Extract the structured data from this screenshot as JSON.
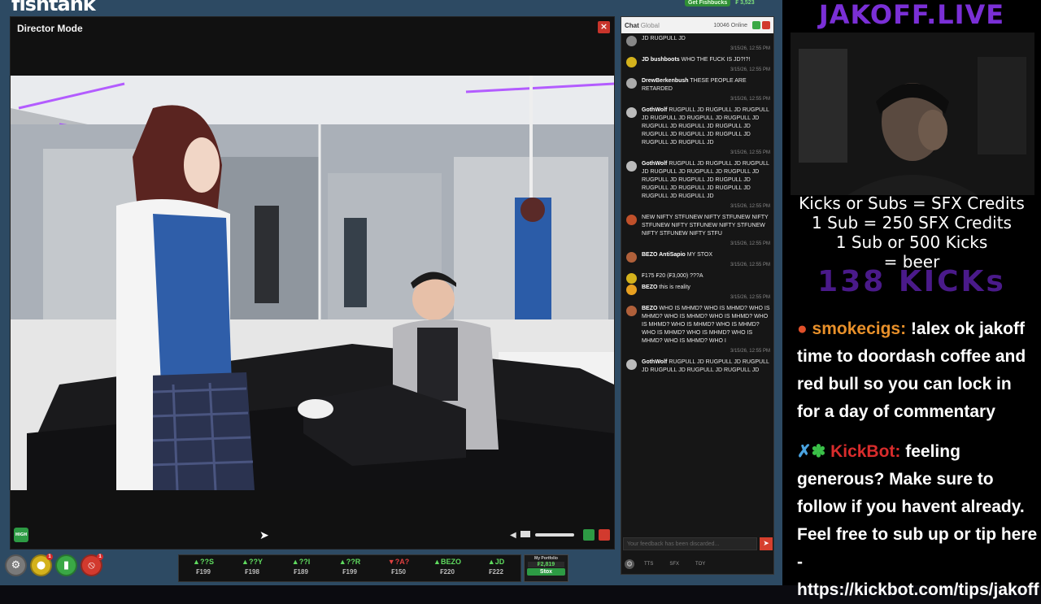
{
  "app": {
    "logo": "fishtank",
    "get_fishbucks": "Get Fishbucks",
    "fishbucks_balance": "₣ 3,523"
  },
  "director": {
    "title": "Director Mode",
    "close": "×",
    "quality_badge": "HIGH"
  },
  "stox": {
    "items": [
      {
        "symbol": "▲??S",
        "price": "₣199",
        "dir": "up"
      },
      {
        "symbol": "▲??Y",
        "price": "₣198",
        "dir": "up"
      },
      {
        "symbol": "▲??I",
        "price": "₣189",
        "dir": "up"
      },
      {
        "symbol": "▲??R",
        "price": "₣199",
        "dir": "up"
      },
      {
        "symbol": "▼?A?",
        "price": "₣150",
        "dir": "down"
      },
      {
        "symbol": "▲BEZO",
        "price": "₣220",
        "dir": "up"
      },
      {
        "symbol": "▲JD",
        "price": "₣222",
        "dir": "up"
      }
    ],
    "portfolio_title": "My Portfolio",
    "portfolio_value": "₣2,819",
    "stox_button": "Stox"
  },
  "bottom_icons": [
    {
      "name": "settings-icon",
      "glyph": "⚙",
      "color": "#7a7a7a",
      "badge": ""
    },
    {
      "name": "coins-icon",
      "glyph": "●",
      "color": "#d4b21c",
      "badge": "1"
    },
    {
      "name": "drink-icon",
      "glyph": "▮",
      "color": "#3aa845",
      "badge": ""
    },
    {
      "name": "no-entry-icon",
      "glyph": "⦸",
      "color": "#d23a2e",
      "badge": "1"
    }
  ],
  "chat": {
    "title": "Chat",
    "subtitle": "Global",
    "online": "10046 Online",
    "input_placeholder": "Your feedback has been discarded...",
    "send": "➤",
    "tabs": [
      "TTS",
      "SFX",
      "TOY"
    ],
    "messages": [
      {
        "user": "",
        "text": "JD RUGPULL JD",
        "ts": "3/15/26, 12:55 PM",
        "av": "#888"
      },
      {
        "user": "JD bushboots",
        "text": "WHO THE FUCK IS JD?!?!",
        "ts": "3/15/26, 12:55 PM",
        "av": "#d4b21c"
      },
      {
        "user": "DrewBerkenbush",
        "text": "THESE PEOPLE ARE RETARDED",
        "ts": "3/15/26, 12:55 PM",
        "av": "#aaa"
      },
      {
        "user": "GothWolf",
        "text": "RUGPULL JD RUGPULL JD RUGPULL JD RUGPULL JD RUGPULL JD RUGPULL JD RUGPULL JD RUGPULL JD RUGPULL JD RUGPULL JD RUGPULL JD RUGPULL JD RUGPULL JD RUGPULL JD",
        "ts": "3/15/26, 12:55 PM",
        "av": "#bbb"
      },
      {
        "user": "GothWolf",
        "text": "RUGPULL JD RUGPULL JD RUGPULL JD RUGPULL JD RUGPULL JD RUGPULL JD RUGPULL JD RUGPULL JD RUGPULL JD RUGPULL JD RUGPULL JD RUGPULL JD RUGPULL JD RUGPULL JD",
        "ts": "3/15/26, 12:55 PM",
        "av": "#bbb"
      },
      {
        "user": "",
        "text": "NEW NIFTY STFUNEW NIFTY STFUNEW NIFTY STFUNEW NIFTY STFUNEW NIFTY STFUNEW NIFTY STFUNEW NIFTY STFU",
        "ts": "3/15/26, 12:55 PM",
        "av": "#c0502a"
      },
      {
        "user": "BEZO AntiSapio",
        "text": "MY STOX",
        "ts": "3/15/26, 12:55 PM",
        "av": "#b0603a"
      },
      {
        "user": "",
        "text": "₣175 ₣20 (₣3,000) ???A",
        "ts": "",
        "av": "#d4b21c"
      },
      {
        "user": "BEZO",
        "text": "this is reality",
        "ts": "3/15/26, 12:55 PM",
        "av": "#e8a020"
      },
      {
        "user": "BEZO",
        "text": "WHO IS MHMD? WHO IS MHMD? WHO IS MHMD? WHO IS MHMD? WHO IS MHMD? WHO IS MHMD? WHO IS MHMD? WHO IS MHMD? WHO IS MHMD? WHO IS MHMD? WHO IS MHMD? WHO IS MHMD? WHO I",
        "ts": "3/15/26, 12:55 PM",
        "av": "#b0603a"
      },
      {
        "user": "GothWolf",
        "text": "RUGPULL JD RUGPULL JD RUGPULL JD RUGPULL JD RUGPULL JD RUGPULL JD",
        "ts": "",
        "av": "#bbb"
      }
    ]
  },
  "overlay": {
    "brand": "JAKOFF.LIVE",
    "credit_lines": [
      "Kicks or Subs = SFX Credits",
      "1 Sub = 250 SFX Credits",
      "1 Sub or 500 Kicks",
      "= beer"
    ],
    "kicks_counter": "138 KICKs",
    "msg1_user": "smokecigs:",
    "msg1_text": "!alex ok jakoff time to doordash coffee and red bull so you can lock in for a day of commentary",
    "msg2_user": "KickBot:",
    "msg2_text": "feeling generous? Make sure to follow if you havent already. Feel free to sub up or tip here - https://kickbot.com/tips/jakoff"
  }
}
